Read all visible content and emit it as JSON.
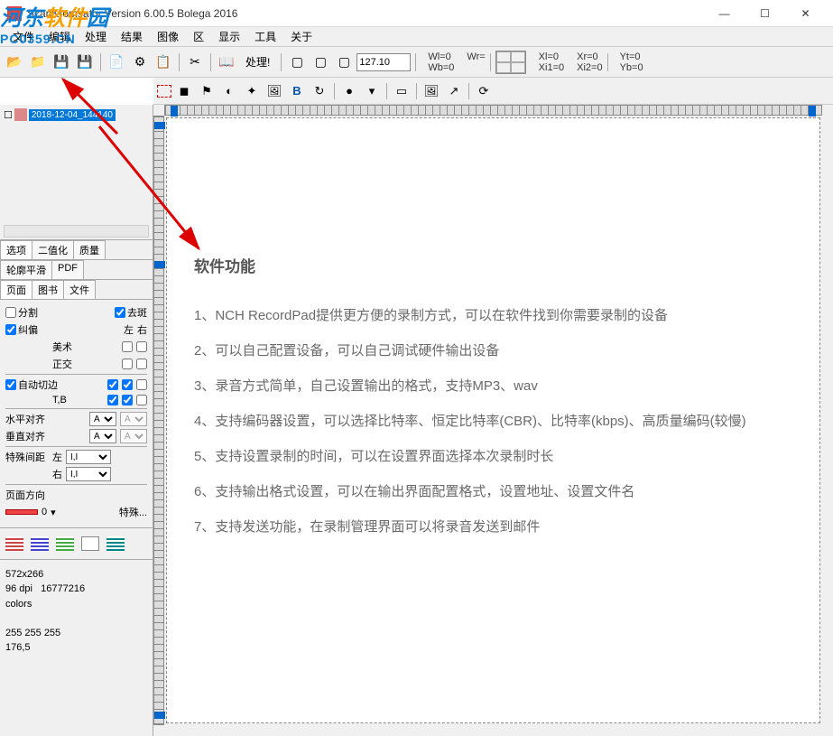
{
  "window": {
    "title": "ScanKromsator      Version 6.00.5      Bolega 2016"
  },
  "menu": [
    "文件",
    "编辑",
    "处理",
    "结果",
    "图像",
    "区",
    "显示",
    "工具",
    "关于"
  ],
  "toolbar": {
    "process_label": "处理!",
    "zoom_value": "127.10",
    "wl": "Wl=0",
    "wr": "Wr=",
    "wb": "Wb=0",
    "xl": "Xl=0",
    "xr": "Xr=0",
    "xi1": "Xi1=0",
    "xi2": "Xi2=0",
    "yt": "Yt=0",
    "yb": "Yb=0"
  },
  "thumb": {
    "filename": "2018-12-04_144140"
  },
  "tabs1": [
    "选项",
    "二值化",
    "质量"
  ],
  "tabs2": [
    "轮廓平滑",
    "PDF"
  ],
  "tabs3": [
    "页面",
    "图书",
    "文件"
  ],
  "opts": {
    "split": "分割",
    "despeckle": "去斑",
    "deskew": "纠偏",
    "left": "左",
    "right": "右",
    "art": "美术",
    "ortho": "正交",
    "autocut": "自动切边",
    "tb": "T,B",
    "halign": "水平对齐",
    "valign": "垂直对齐",
    "halign_val": "A",
    "valign_val": "A",
    "special_gap": "特殊间距",
    "left2": "左",
    "right2": "右",
    "gap_val": "I,I",
    "page_dir": "页面方向",
    "page_dir_val": "0",
    "special": "特殊..."
  },
  "info": {
    "dims": "572x266",
    "dpi": "96 dpi   16777216",
    "colors": "colors",
    "rgb": "255 255 255",
    "pos": "176,5"
  },
  "doc": {
    "heading": "软件功能",
    "lines": [
      "1、NCH RecordPad提供更方便的录制方式，可以在软件找到你需要录制的设备",
      "2、可以自己配置设备，可以自己调试硬件输出设备",
      "3、录音方式简单，自己设置输出的格式，支持MP3、wav",
      "4、支持编码器设置，可以选择比特率、恒定比特率(CBR)、比特率(kbps)、高质量编码(较慢)",
      "5、支持设置录制的时间，可以在设置界面选择本次录制时长",
      "6、支持输出格式设置，可以在输出界面配置格式，设置地址、设置文件名",
      "7、支持发送功能，在录制管理界面可以将录音发送到邮件"
    ]
  }
}
